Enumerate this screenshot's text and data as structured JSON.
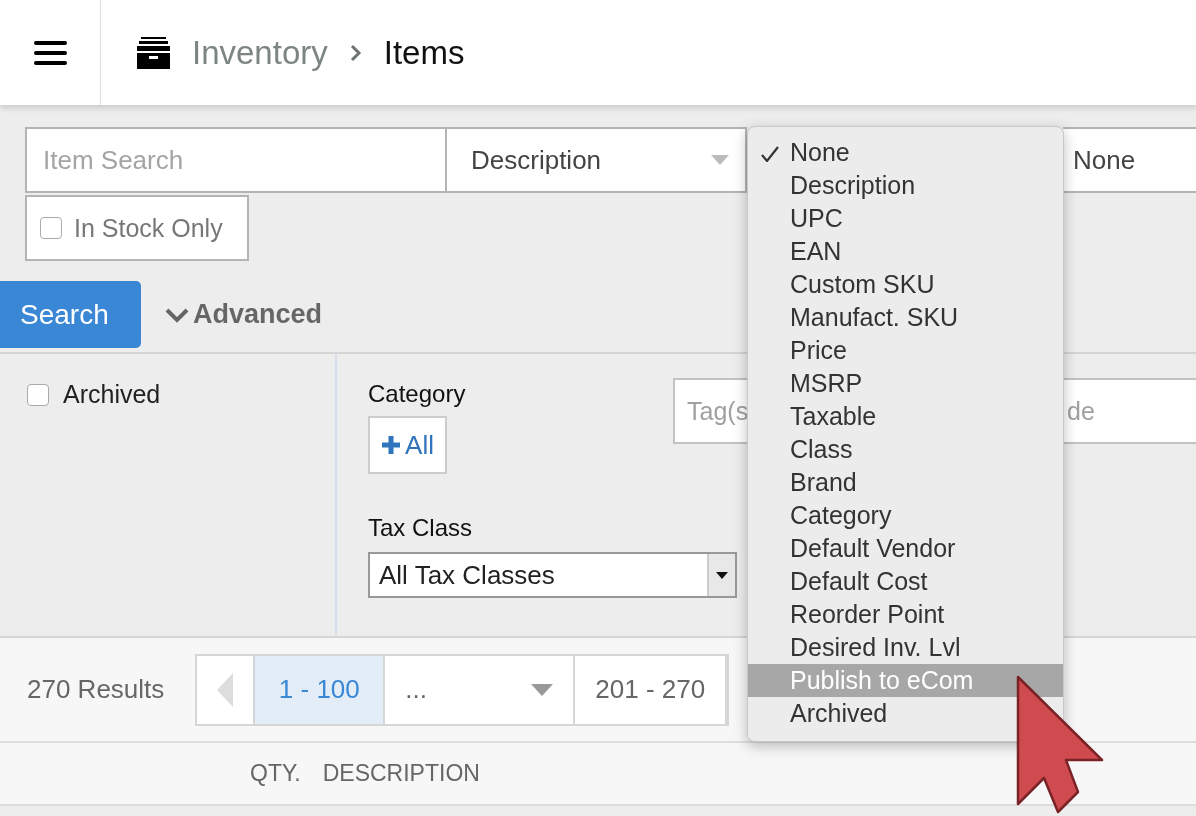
{
  "header": {
    "breadcrumb": [
      {
        "label": "Inventory",
        "current": false
      },
      {
        "label": "Items",
        "current": true
      }
    ]
  },
  "search": {
    "placeholder": "Item Search",
    "field": {
      "value": "Description"
    },
    "filter": {
      "value": "None"
    },
    "in_stock": {
      "label": "In Stock Only",
      "checked": false
    },
    "button": "Search",
    "advanced": {
      "label": "Advanced",
      "expanded": true
    }
  },
  "advanced": {
    "archived": {
      "label": "Archived",
      "checked": false
    },
    "category": {
      "label": "Category",
      "button": "All"
    },
    "tax_class": {
      "label": "Tax Class",
      "value": "All Tax Classes"
    },
    "tags": {
      "placeholder": "Tag(s"
    },
    "field_4": {
      "placeholder": "de"
    }
  },
  "pagination": {
    "results": "270 Results",
    "pages": [
      {
        "kind": "page",
        "label": "1 - 100",
        "selected": true
      },
      {
        "kind": "dropdown",
        "label": "...",
        "selected": false
      },
      {
        "kind": "page",
        "label": "201 - 270",
        "selected": false
      }
    ]
  },
  "table": {
    "columns": [
      "QTY.",
      "DESCRIPTION"
    ]
  },
  "menu": {
    "items": [
      {
        "label": "None",
        "checked": true,
        "highlighted": false
      },
      {
        "label": "Description",
        "checked": false,
        "highlighted": false
      },
      {
        "label": "UPC",
        "checked": false,
        "highlighted": false
      },
      {
        "label": "EAN",
        "checked": false,
        "highlighted": false
      },
      {
        "label": "Custom SKU",
        "checked": false,
        "highlighted": false
      },
      {
        "label": "Manufact. SKU",
        "checked": false,
        "highlighted": false
      },
      {
        "label": "Price",
        "checked": false,
        "highlighted": false
      },
      {
        "label": "MSRP",
        "checked": false,
        "highlighted": false
      },
      {
        "label": "Taxable",
        "checked": false,
        "highlighted": false
      },
      {
        "label": "Class",
        "checked": false,
        "highlighted": false
      },
      {
        "label": "Brand",
        "checked": false,
        "highlighted": false
      },
      {
        "label": "Category",
        "checked": false,
        "highlighted": false
      },
      {
        "label": "Default Vendor",
        "checked": false,
        "highlighted": false
      },
      {
        "label": "Default Cost",
        "checked": false,
        "highlighted": false
      },
      {
        "label": "Reorder Point",
        "checked": false,
        "highlighted": false
      },
      {
        "label": "Desired Inv. Lvl",
        "checked": false,
        "highlighted": false
      },
      {
        "label": "Publish to eCom",
        "checked": false,
        "highlighted": true
      },
      {
        "label": "Archived",
        "checked": false,
        "highlighted": false
      }
    ]
  }
}
